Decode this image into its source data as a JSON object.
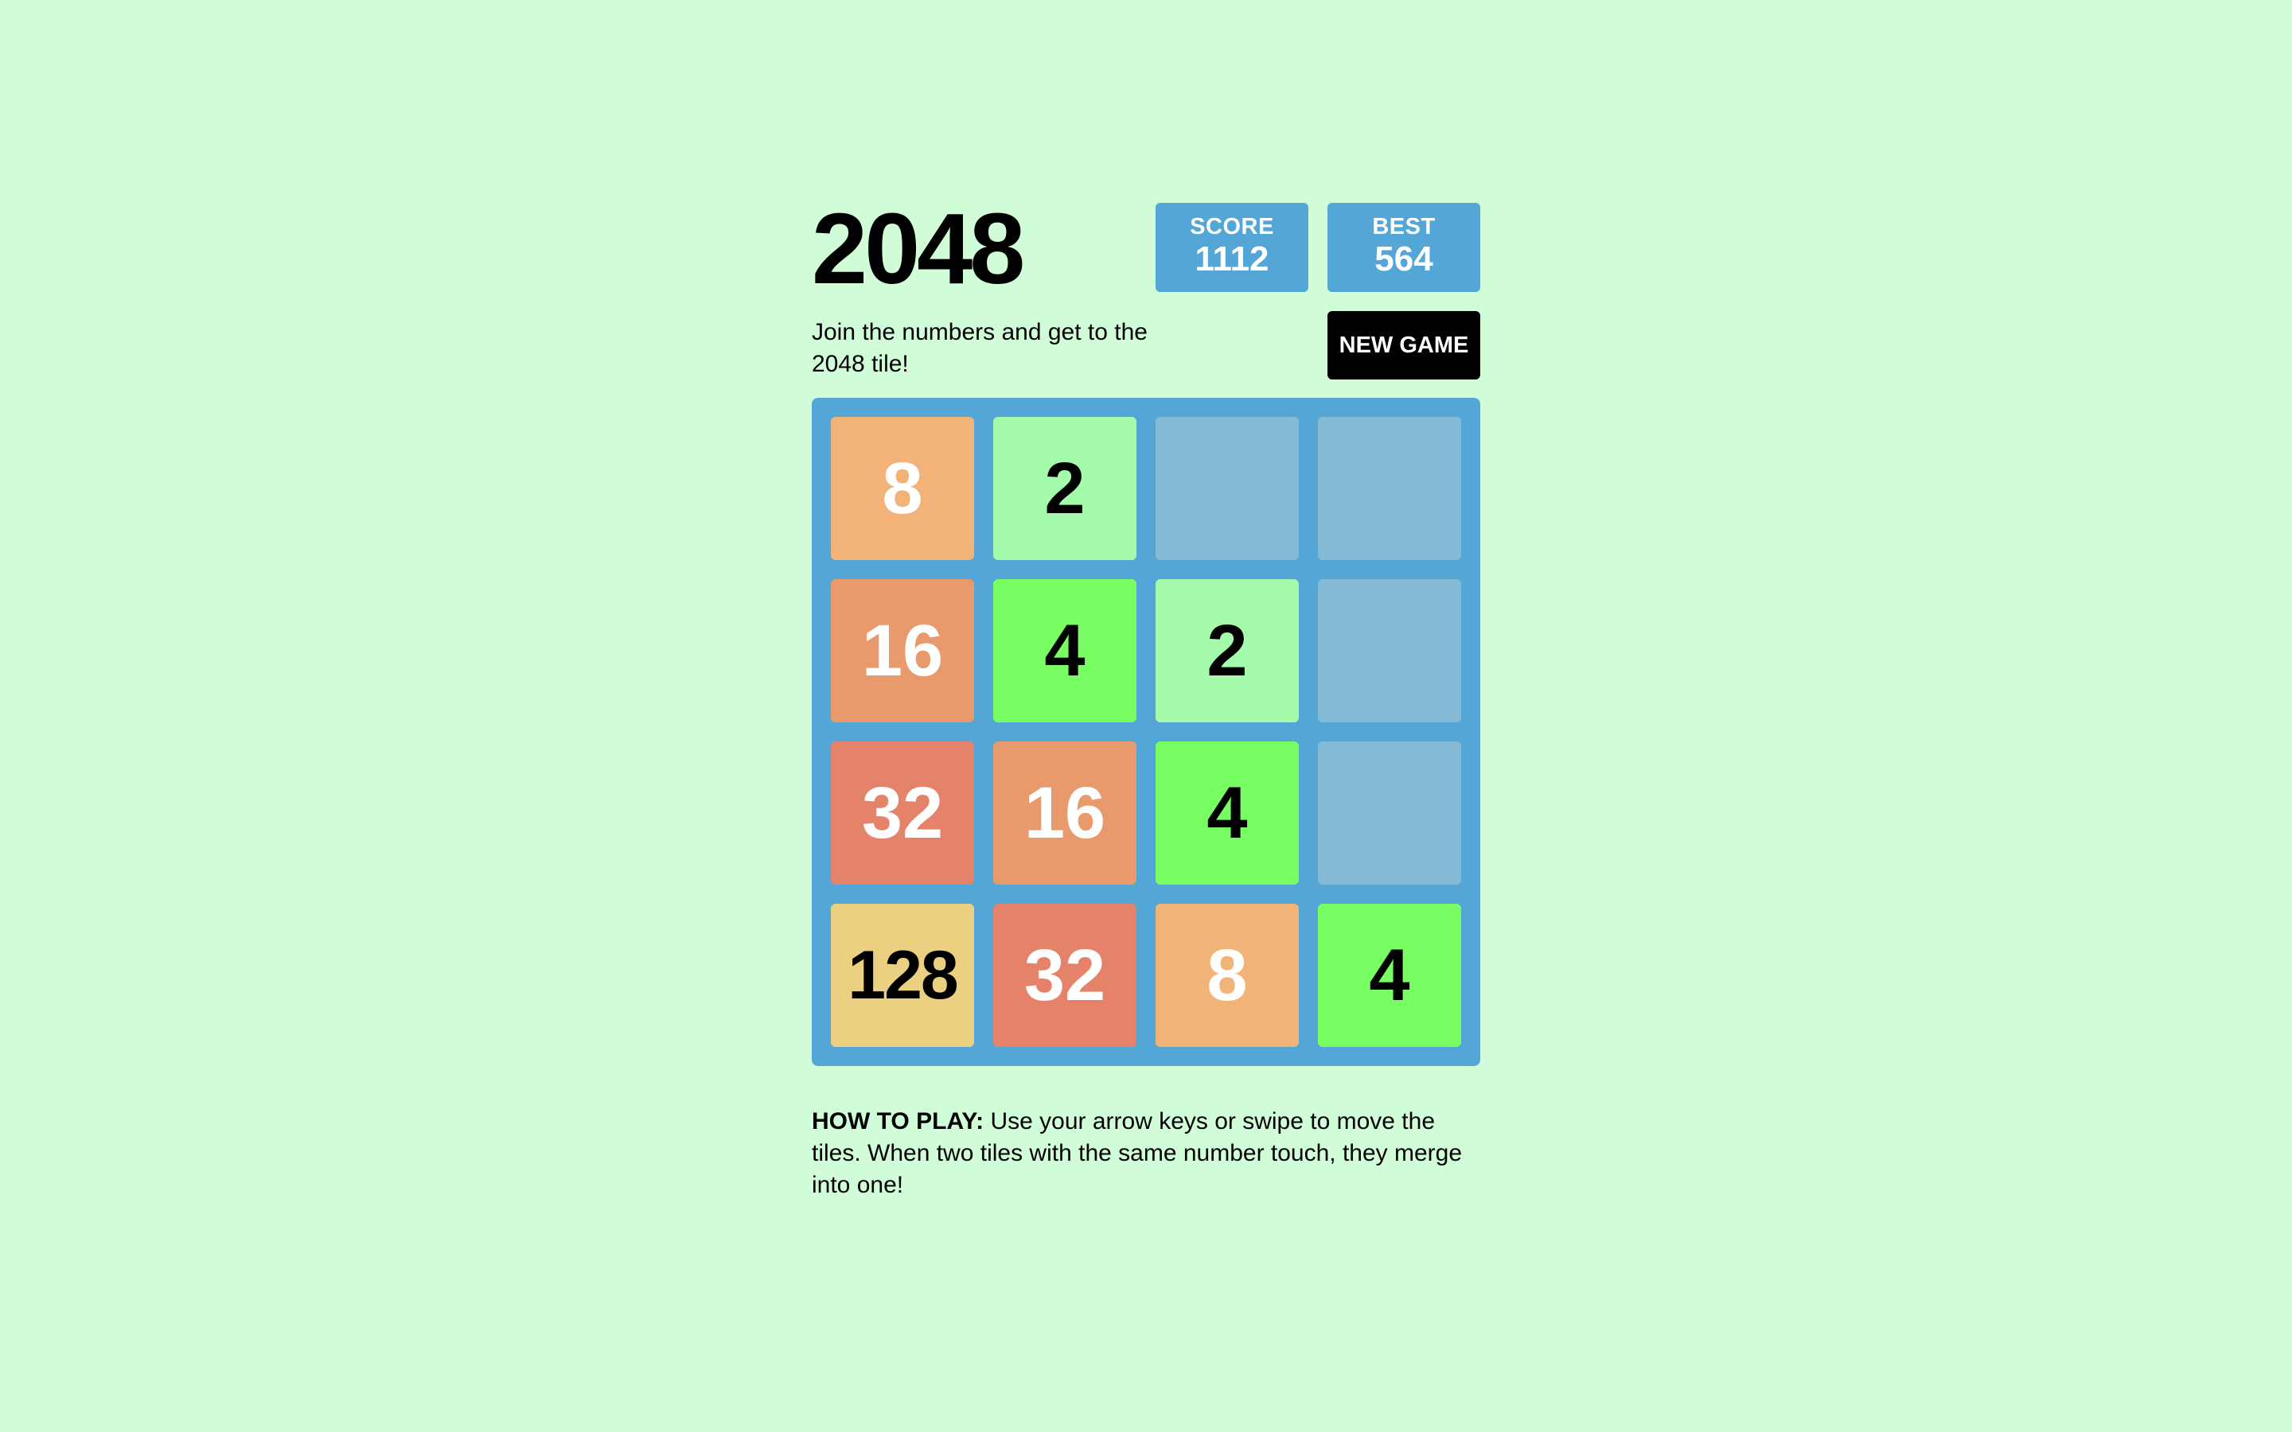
{
  "game": {
    "title": "2048",
    "intro": "Join the numbers and get to the 2048 tile!",
    "new_game_label": "NEW GAME"
  },
  "scores": {
    "score_label": "SCORE",
    "score_value": "1112",
    "best_label": "BEST",
    "best_value": "564"
  },
  "board": {
    "rows": [
      [
        "8",
        "2",
        "",
        ""
      ],
      [
        "16",
        "4",
        "2",
        ""
      ],
      [
        "32",
        "16",
        "4",
        ""
      ],
      [
        "128",
        "32",
        "8",
        "4"
      ]
    ]
  },
  "tile_colors": {
    "empty": "#85bad4",
    "2": "#a3fbab",
    "4": "#78fd63",
    "8": "#f2b379",
    "16": "#e89a6d",
    "32": "#e5836a",
    "128": "#ead080"
  },
  "tile_text_colors": {
    "2": "#000000",
    "4": "#000000",
    "8": "#ffffff",
    "16": "#ffffff",
    "32": "#ffffff",
    "128": "#000000"
  },
  "instructions": {
    "label": "HOW TO PLAY:",
    "text": " Use your arrow keys or swipe to move the tiles. When two tiles with the same number touch, they merge into one!"
  }
}
